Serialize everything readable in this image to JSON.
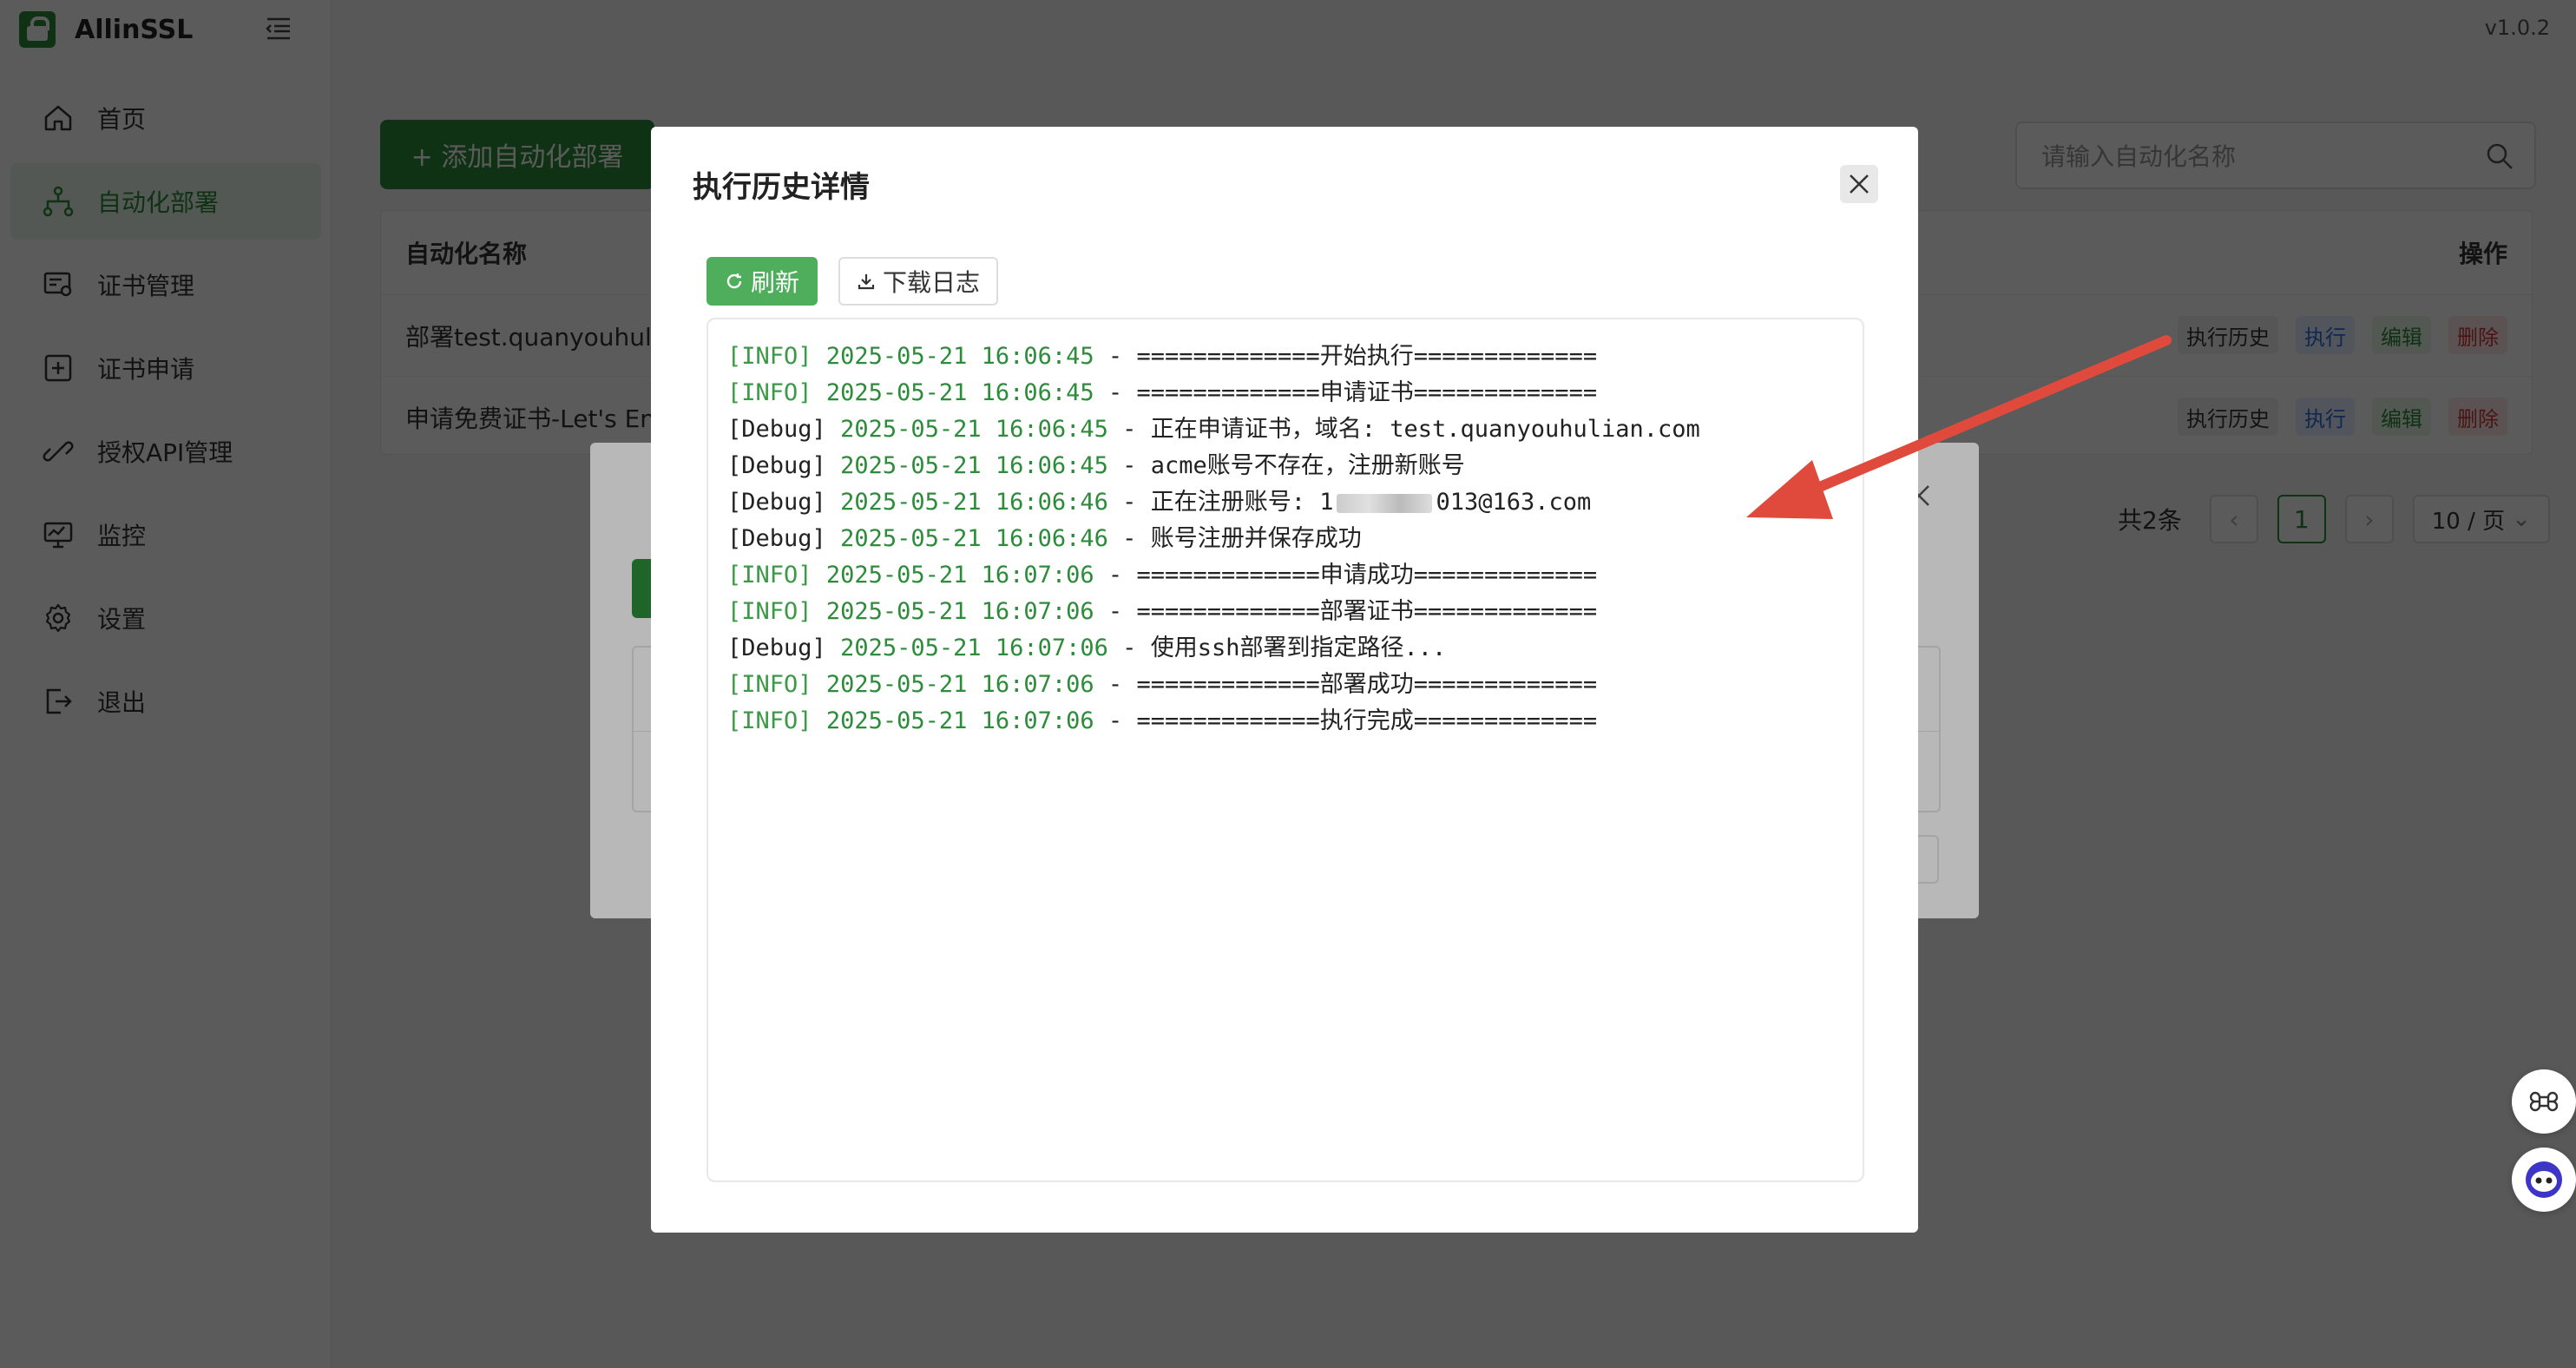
{
  "app": {
    "name": "AllinSSL",
    "version": "v1.0.2"
  },
  "sidebar": {
    "items": [
      {
        "label": "首页",
        "icon": "home-icon"
      },
      {
        "label": "自动化部署",
        "icon": "workflow-icon",
        "active": true
      },
      {
        "label": "证书管理",
        "icon": "certificate-icon"
      },
      {
        "label": "证书申请",
        "icon": "plus-square-icon"
      },
      {
        "label": "授权API管理",
        "icon": "api-link-icon"
      },
      {
        "label": "监控",
        "icon": "monitor-icon"
      },
      {
        "label": "设置",
        "icon": "gear-icon"
      },
      {
        "label": "退出",
        "icon": "logout-icon"
      }
    ]
  },
  "main": {
    "add_button": "+ 添加自动化部署",
    "search_placeholder": "请输入自动化名称",
    "table": {
      "columns": [
        "自动化名称",
        "操作"
      ],
      "rows": [
        {
          "name": "部署test.quanyouhulia"
        },
        {
          "name": "申请免费证书-Let's Enc"
        }
      ],
      "ops": {
        "history": "执行历史",
        "run": "执行",
        "edit": "编辑",
        "delete": "删除"
      }
    },
    "pagination": {
      "total": "共2条",
      "current": "1",
      "page_size": "10 / 页"
    }
  },
  "dialog": {
    "title": "执行历史详情",
    "refresh_label": "刷新",
    "download_label": "下载日志",
    "log": [
      {
        "level": "[INFO]",
        "time": "2025-05-21 16:06:45",
        "msg": " - =============开始执行============="
      },
      {
        "level": "[INFO]",
        "time": "2025-05-21 16:06:45",
        "msg": " - =============申请证书============="
      },
      {
        "level": "[Debug]",
        "time": "2025-05-21 16:06:45",
        "msg": " - 正在申请证书，域名: test.quanyouhulian.com"
      },
      {
        "level": "[Debug]",
        "time": "2025-05-21 16:06:45",
        "msg": " - acme账号不存在，注册新账号"
      },
      {
        "level": "[Debug]",
        "time": "2025-05-21 16:06:46",
        "msg": " - 正在注册账号: 1",
        "masked": true,
        "msg_tail": "013@163.com"
      },
      {
        "level": "[Debug]",
        "time": "2025-05-21 16:06:46",
        "msg": " - 账号注册并保存成功"
      },
      {
        "level": "[INFO]",
        "time": "2025-05-21 16:07:06",
        "msg": " - =============申请成功============="
      },
      {
        "level": "[INFO]",
        "time": "2025-05-21 16:07:06",
        "msg": " - =============部署证书============="
      },
      {
        "level": "[Debug]",
        "time": "2025-05-21 16:07:06",
        "msg": " - 使用ssh部署到指定路径..."
      },
      {
        "level": "[INFO]",
        "time": "2025-05-21 16:07:06",
        "msg": " - =============部署成功============="
      },
      {
        "level": "[INFO]",
        "time": "2025-05-21 16:07:06",
        "msg": " - =============执行完成============="
      }
    ]
  },
  "colors": {
    "brand": "#2c8c3a",
    "arrow": "#e04a3c"
  }
}
